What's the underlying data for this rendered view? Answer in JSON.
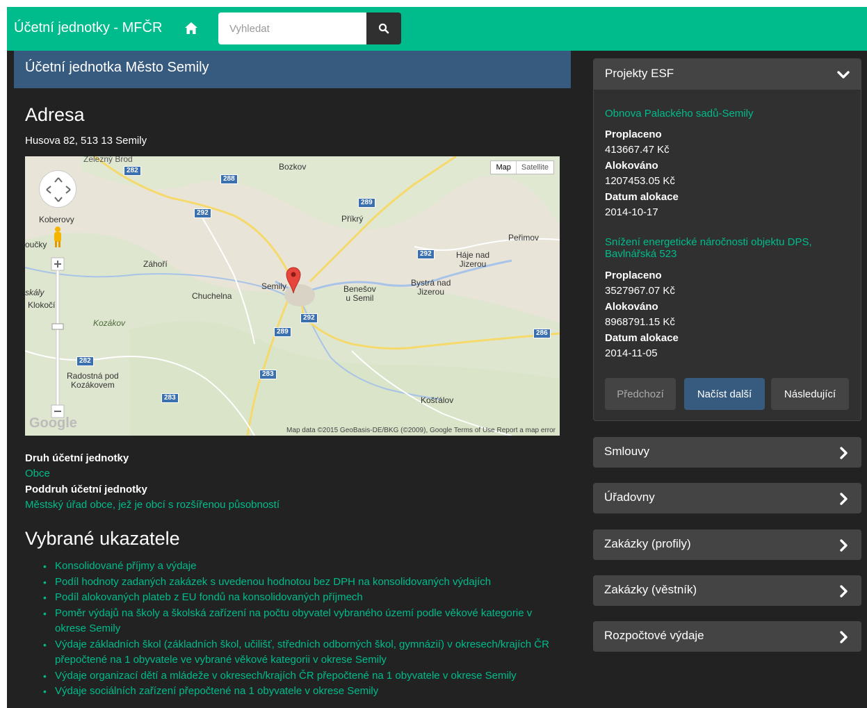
{
  "navbar": {
    "brand": "Účetní jednotky - MFČR",
    "search_placeholder": "Vyhledat"
  },
  "entity": {
    "title": "Účetní jednotka Město Semily"
  },
  "address": {
    "heading": "Adresa",
    "text": "Husova 82, 513 13 Semily"
  },
  "map": {
    "type_map": "Map",
    "type_satellite": "Satellite",
    "footer": "Map data ©2015 GeoBasis-DE/BKG (©2009), Google   Terms of Use   Report a map error",
    "logo": "Google",
    "labels": {
      "zelezny_brod": "Železný Brod",
      "bozkov": "Bozkov",
      "koberovy": "Koberovy",
      "loucky": "oučky",
      "zahori": "Záhoří",
      "prikry": "Příkrý",
      "perimov": "Peřimov",
      "haje": "Háje nad\nJizerou",
      "semily": "Semily",
      "benesov": "Benešov\nu Semil",
      "bystra": "Bystrá nad\nJizerou",
      "chuchelna": "Chuchelna",
      "skaly": "skály",
      "klokoci": "Klokočí",
      "kozakov": "Kozákov",
      "radostna": "Radostná pod\nKozákovem",
      "kostalov": "Košťálov"
    },
    "roads": [
      "282",
      "288",
      "292",
      "289",
      "292",
      "292",
      "289",
      "286",
      "282",
      "283",
      "283"
    ]
  },
  "details": {
    "druh_label": "Druh účetní jednotky",
    "druh_value": "Obce",
    "poddruh_label": "Poddruh účetní jednotky",
    "poddruh_value": "Městský úřad obce, jež je obcí s rozšířenou působností"
  },
  "indicators": {
    "heading": "Vybrané ukazatele",
    "items": [
      "Konsolidované příjmy a výdaje",
      "Podíl hodnoty zadaných zakázek s uvedenou hodnotou bez DPH na konsolidovaných výdajích",
      "Podíl alokovaných plateb z EU fondů na konsolidovaných příjmech",
      "Poměr výdajů na školy a školská zařízení na počtu obyvatel vybraného území podle věkové kategorie v okrese Semily",
      "Výdaje základních škol (základních škol, učilišť, středních odborných škol, gymnázií) v okresech/krajích ČR přepočtené na 1 obyvatele ve vybrané věkové kategorii v okrese Semily",
      "Výdaje organizací dětí a mládeže v okresech/krajích ČR přepočtené na 1 obyvatele v okrese Semily",
      "Výdaje sociálních zařízení přepočtené na 1 obyvatele v okrese Semily"
    ]
  },
  "esf": {
    "title": "Projekty ESF",
    "projects": [
      {
        "name": "Obnova Palackého sadů-Semily",
        "paid_label": "Proplaceno",
        "paid": "413667.47 Kč",
        "alloc_label": "Alokováno",
        "alloc": "1207453.05 Kč",
        "date_label": "Datum alokace",
        "date": "2014-10-17"
      },
      {
        "name": "Snížení energetické náročnosti objektu DPS, Bavlnářská 523",
        "paid_label": "Proplaceno",
        "paid": "3527967.07 Kč",
        "alloc_label": "Alokováno",
        "alloc": "8968791.15 Kč",
        "date_label": "Datum alokace",
        "date": "2014-11-05"
      }
    ],
    "btn_prev": "Předchozí",
    "btn_load": "Načíst další",
    "btn_next": "Následující"
  },
  "sections": [
    "Smlouvy",
    "Úřadovny",
    "Zakázky (profily)",
    "Zakázky (věstník)",
    "Rozpočtové výdaje"
  ],
  "colors": {
    "accent": "#00bc8c",
    "primary": "#375a7f",
    "background": "#222222",
    "panel": "#444444"
  }
}
